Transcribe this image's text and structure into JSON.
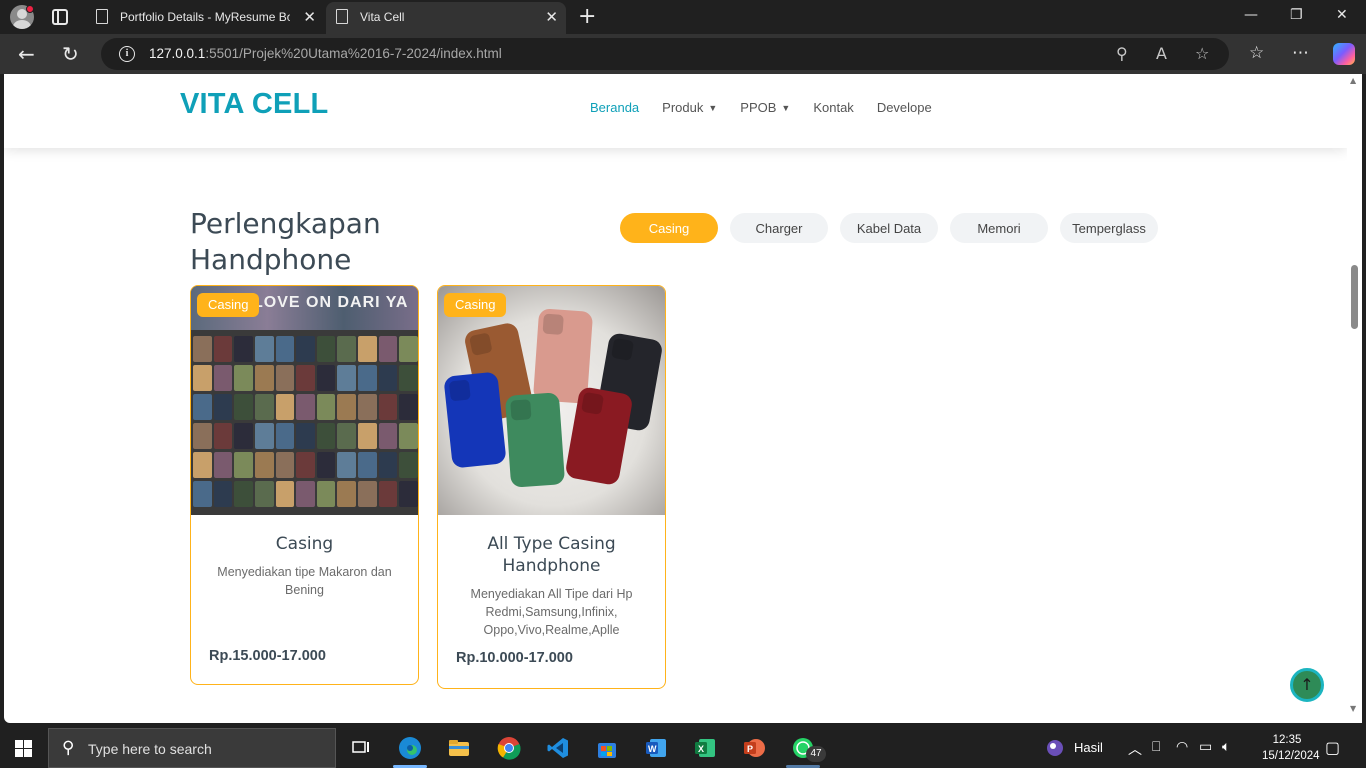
{
  "browser": {
    "tabs": [
      {
        "title": "Portfolio Details - MyResume Boo",
        "close": "✕"
      },
      {
        "title": "Vita Cell",
        "close": "✕"
      }
    ],
    "new_tab": "+",
    "window_controls": {
      "minimize": "—",
      "maximize": "❐",
      "close": "✕"
    },
    "url_host": "127.0.0.1",
    "url_rest": ":5501/Projek%20Utama%2016-7-2024/index.html"
  },
  "site": {
    "logo": "VITA CELL",
    "nav": [
      {
        "label": "Beranda",
        "active": true,
        "dropdown": false
      },
      {
        "label": "Produk",
        "active": false,
        "dropdown": true
      },
      {
        "label": "PPOB",
        "active": false,
        "dropdown": true
      },
      {
        "label": "Kontak",
        "active": false,
        "dropdown": false
      },
      {
        "label": "Develope",
        "active": false,
        "dropdown": false
      }
    ],
    "section_title_line1": "Perlengkapan",
    "section_title_line2": "Handphone",
    "filters": [
      "Casing",
      "Charger",
      "Kabel Data",
      "Memori",
      "Temperglass"
    ],
    "active_filter": "Casing",
    "products": [
      {
        "badge": "Casing",
        "image_caption": "LOVE ON DARI YA",
        "name": "Casing",
        "description": "Menyediakan tipe Makaron dan Bening",
        "price": "Rp.15.000-17.000"
      },
      {
        "badge": "Casing",
        "name": "All Type Casing Handphone",
        "description": "Menyediakan All Tipe dari Hp Redmi,Samsung,Infinix, Oppo,Vivo,Realme,Aplle",
        "price": "Rp.10.000-17.000"
      }
    ],
    "back_to_top": "↑"
  },
  "taskbar": {
    "search_placeholder": "Type here to search",
    "whatsapp_badge": "47",
    "weather_label": "Hasil",
    "time": "12:35",
    "date": "15/12/2024"
  },
  "colors": {
    "accent": "#0fa0b8",
    "orange": "#ffb31a",
    "heading": "#3c4a55"
  }
}
